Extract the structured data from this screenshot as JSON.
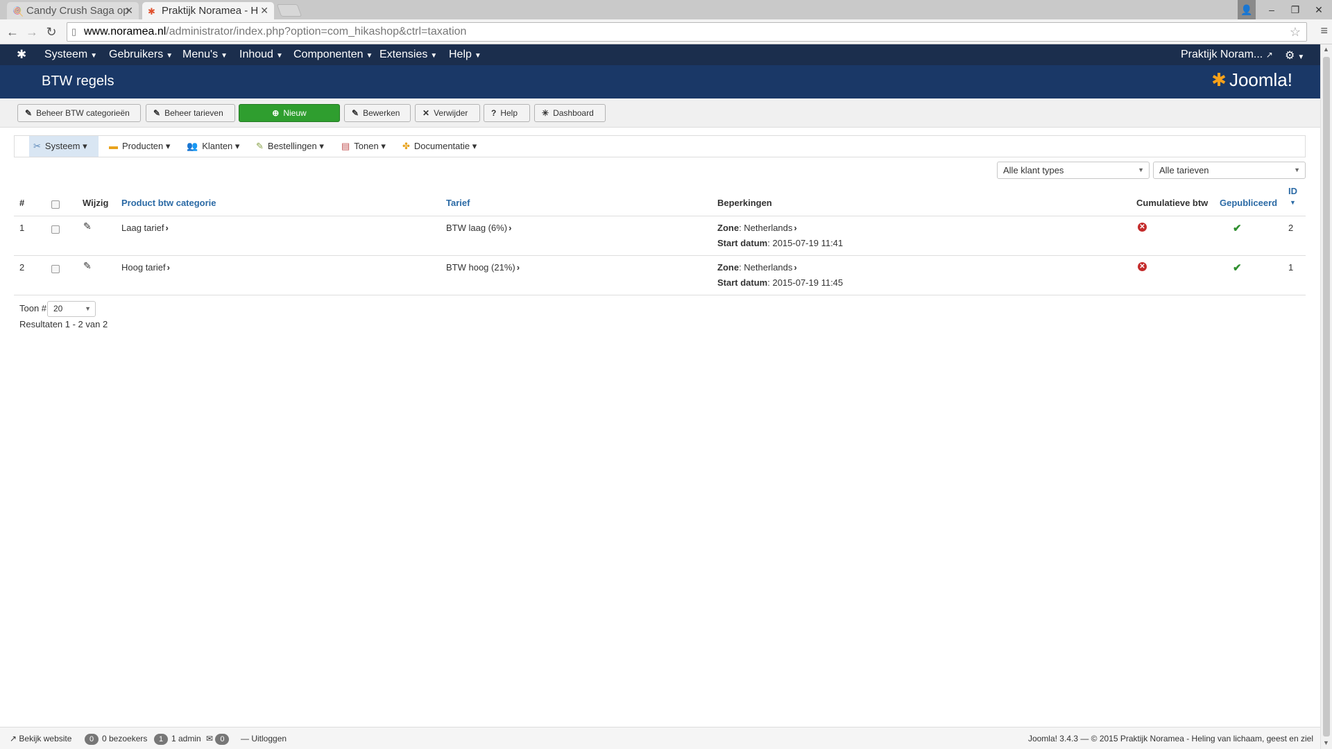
{
  "browser": {
    "tabs": [
      {
        "title": "Candy Crush Saga op",
        "active": false
      },
      {
        "title": "Praktijk Noramea - H",
        "active": true
      }
    ],
    "url_host": "www.noramea.nl",
    "url_path": "/administrator/index.php?option=com_hikashop&ctrl=taxation"
  },
  "topnav": {
    "items": [
      "Systeem",
      "Gebruikers",
      "Menu's",
      "Inhoud",
      "Componenten",
      "Extensies",
      "Help"
    ],
    "site_name": "Praktijk Noram..."
  },
  "header": {
    "title": "BTW regels",
    "brand": "Joomla!"
  },
  "toolbar": {
    "manage_categories": "Beheer BTW categorieën",
    "manage_rates": "Beheer tarieven",
    "new": "Nieuw",
    "edit": "Bewerken",
    "delete": "Verwijder",
    "help": "Help",
    "dashboard": "Dashboard"
  },
  "submenu": {
    "items": [
      "Systeem",
      "Producten",
      "Klanten",
      "Bestellingen",
      "Tonen",
      "Documentatie"
    ]
  },
  "filters": {
    "customer_type": "Alle klant types",
    "rates": "Alle tarieven"
  },
  "table": {
    "headers": {
      "num": "#",
      "edit": "Wijzig",
      "category": "Product btw categorie",
      "rate": "Tarief",
      "restrictions": "Beperkingen",
      "cumulative": "Cumulatieve btw",
      "published": "Gepubliceerd",
      "id": "ID"
    },
    "zone_label": "Zone",
    "start_label": "Start datum",
    "rows": [
      {
        "num": "1",
        "category": "Laag tarief",
        "rate": "BTW laag (6%)",
        "zone": "Netherlands",
        "start": "2015-07-19 11:41",
        "cumulative": false,
        "published": true,
        "id": "2"
      },
      {
        "num": "2",
        "category": "Hoog tarief",
        "rate": "BTW hoog (21%)",
        "zone": "Netherlands",
        "start": "2015-07-19 11:45",
        "cumulative": false,
        "published": true,
        "id": "1"
      }
    ]
  },
  "pagination": {
    "show_label": "Toon #",
    "limit": "20",
    "results": "Resultaten 1 - 2 van 2"
  },
  "statusbar": {
    "view_site": "Bekijk website",
    "visitors_count": "0",
    "visitors": "0 bezoekers",
    "admins_count": "1",
    "admins": "1 admin",
    "messages_count": "0",
    "logout": "Uitloggen",
    "footer": "Joomla! 3.4.3 — © 2015 Praktijk Noramea - Heling van lichaam, geest en ziel"
  },
  "colors": {
    "nav_bg": "#1b2e4d",
    "header_bg": "#1a3867",
    "primary_button": "#2f9e2f",
    "link": "#2b6aa5",
    "error": "#c42b2b",
    "success": "#2f8f2f"
  }
}
